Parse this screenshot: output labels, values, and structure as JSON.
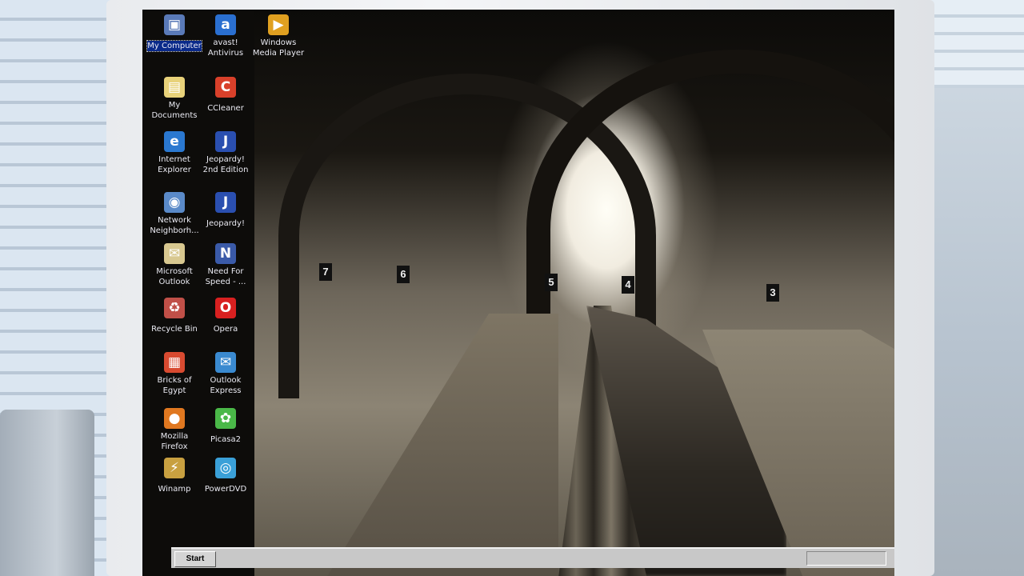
{
  "desktop": {
    "icons": [
      {
        "label": "My Computer",
        "icon": "computer-icon",
        "color": "#5a7ab8",
        "selected": true
      },
      {
        "label": "avast!\nAntivirus",
        "icon": "avast-icon",
        "color": "#2a6fd0",
        "selected": false
      },
      {
        "label": "Windows\nMedia Player",
        "icon": "media-player-icon",
        "color": "#e0a020",
        "selected": false
      },
      {
        "label": "My\nDocuments",
        "icon": "folder-icon",
        "color": "#e8d27a",
        "selected": false
      },
      {
        "label": "CCleaner",
        "icon": "ccleaner-icon",
        "color": "#d8402a",
        "selected": false
      },
      {
        "label": "Internet\nExplorer",
        "icon": "ie-icon",
        "color": "#2a78d0",
        "selected": false
      },
      {
        "label": "Jeopardy!\n2nd Edition",
        "icon": "jeopardy-icon",
        "color": "#2a4fb0",
        "selected": false
      },
      {
        "label": "Network\nNeighborh...",
        "icon": "network-icon",
        "color": "#5a8ac8",
        "selected": false
      },
      {
        "label": "Jeopardy!",
        "icon": "jeopardy-icon",
        "color": "#2a4fb0",
        "selected": false
      },
      {
        "label": "Microsoft\nOutlook",
        "icon": "outlook-icon",
        "color": "#d8c890",
        "selected": false
      },
      {
        "label": "Need For\nSpeed - ...",
        "icon": "nfs-icon",
        "color": "#3a5aa8",
        "selected": false
      },
      {
        "label": "Recycle Bin",
        "icon": "recycle-bin-icon",
        "color": "#c05048",
        "selected": false
      },
      {
        "label": "Opera",
        "icon": "opera-icon",
        "color": "#d82020",
        "selected": false
      },
      {
        "label": "Bricks of\nEgypt",
        "icon": "bricks-icon",
        "color": "#d84a30",
        "selected": false
      },
      {
        "label": "Outlook\nExpress",
        "icon": "outlook-express-icon",
        "color": "#3a8ad0",
        "selected": false
      },
      {
        "label": "Mozilla\nFirefox",
        "icon": "firefox-icon",
        "color": "#e07820",
        "selected": false
      },
      {
        "label": "Picasa2",
        "icon": "picasa-icon",
        "color": "#4ab848",
        "selected": false
      },
      {
        "label": "Winamp",
        "icon": "winamp-icon",
        "color": "#c8a040",
        "selected": false
      },
      {
        "label": "PowerDVD",
        "icon": "powerdvd-icon",
        "color": "#3aa0d8",
        "selected": false
      }
    ]
  },
  "wallpaper": {
    "platform_signs": [
      "7",
      "6",
      "5",
      "4",
      "3"
    ]
  },
  "taskbar": {
    "start_label": "Start"
  }
}
